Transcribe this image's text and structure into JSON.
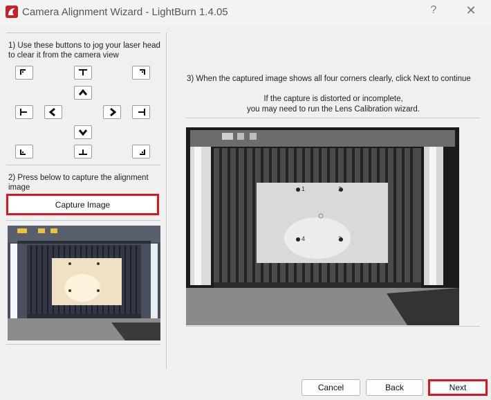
{
  "window": {
    "title": "Camera Alignment Wizard - LightBurn 1.4.05",
    "help_label": "?",
    "close_label": "✕"
  },
  "steps": {
    "step1": "1) Use these buttons to jog your laser head to clear it from the camera view",
    "step2": "2) Press below to capture the alignment image",
    "step3": "3) When the captured image shows all four corners clearly, click Next to continue",
    "note_line1": "If the capture is distorted or incomplete,",
    "note_line2": "you may need to run the Lens Calibration wizard."
  },
  "buttons": {
    "capture": "Capture Image",
    "cancel": "Cancel",
    "back": "Back",
    "next": "Next"
  },
  "image_markers": [
    "1",
    "2",
    "3",
    "4"
  ],
  "colors": {
    "highlight": "#e0141e",
    "logo": "#c8202a"
  }
}
